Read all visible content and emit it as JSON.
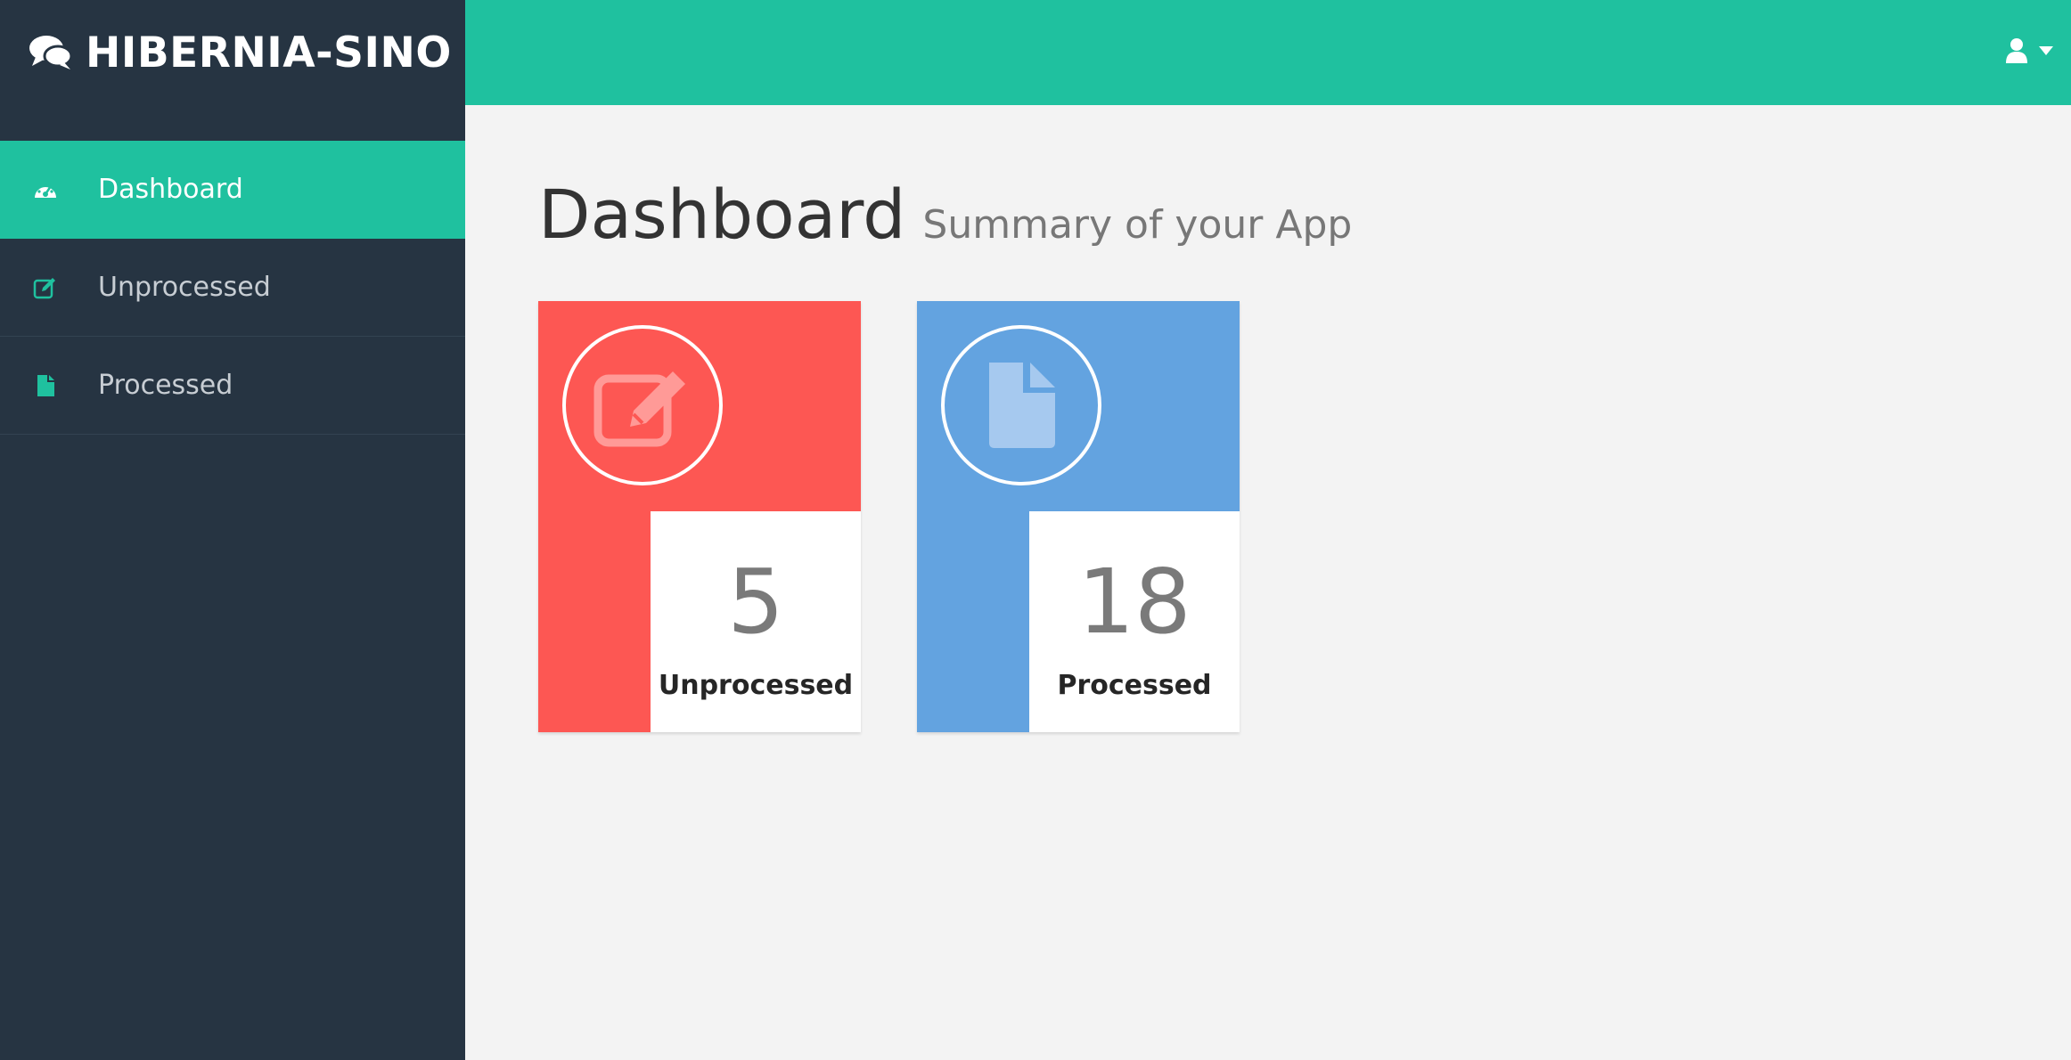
{
  "brand": {
    "title": "HIBERNIA-SINO",
    "icon": "comments-icon"
  },
  "sidebar": {
    "items": [
      {
        "label": "Dashboard",
        "icon": "dashboard-icon",
        "active": true
      },
      {
        "label": "Unprocessed",
        "icon": "edit-icon",
        "active": false
      },
      {
        "label": "Processed",
        "icon": "file-icon",
        "active": false
      }
    ]
  },
  "header": {
    "user_icon": "user-icon",
    "caret_icon": "caret-down-icon"
  },
  "main": {
    "title": "Dashboard",
    "subtitle": "Summary of your App",
    "cards": [
      {
        "value": "5",
        "label": "Unprocessed",
        "icon": "edit-icon",
        "color": "#fd5753"
      },
      {
        "value": "18",
        "label": "Processed",
        "icon": "file-icon",
        "color": "#63a3e0"
      }
    ]
  },
  "colors": {
    "accent": "#1fc19f",
    "sidebar_bg": "#263442",
    "page_bg": "#f3f3f3"
  }
}
